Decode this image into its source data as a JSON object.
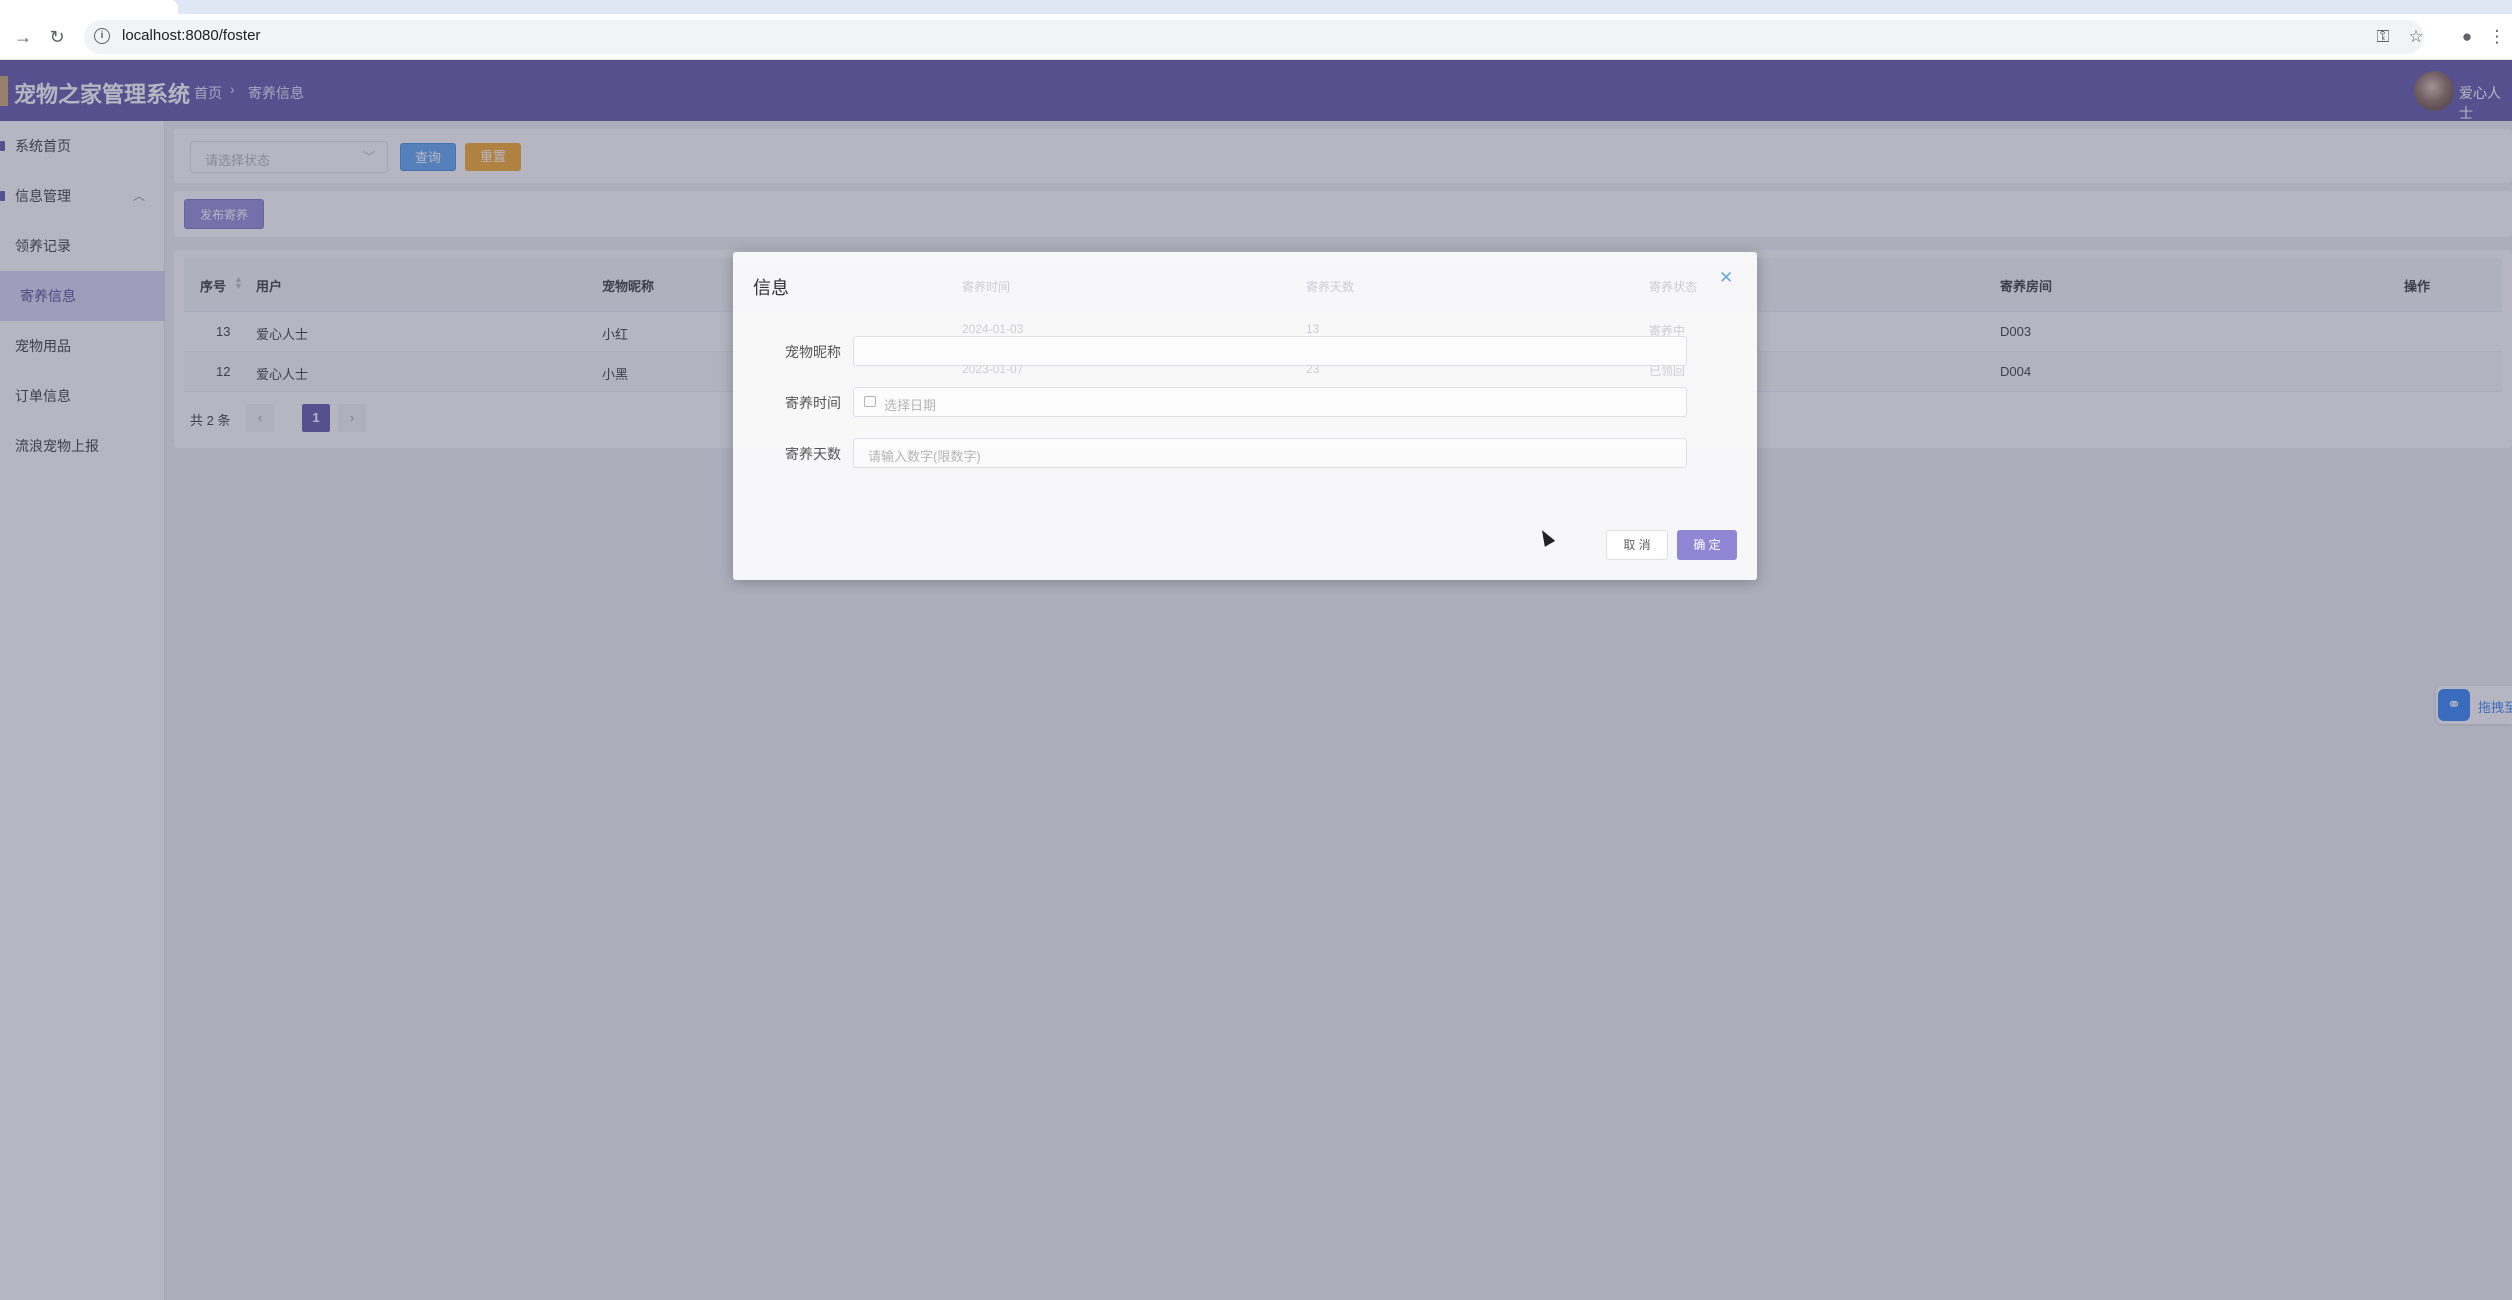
{
  "browser": {
    "url": "localhost:8080/foster"
  },
  "header": {
    "app_title": "宠物之家管理系统",
    "breadcrumb": [
      "首页",
      "寄养信息"
    ],
    "username": "爱心人士"
  },
  "sidebar": {
    "items": [
      {
        "label": "系统首页"
      },
      {
        "label": "信息管理"
      },
      {
        "label": "领养记录"
      },
      {
        "label": "寄养信息"
      },
      {
        "label": "宠物用品"
      },
      {
        "label": "订单信息"
      },
      {
        "label": "流浪宠物上报"
      }
    ]
  },
  "search": {
    "status_placeholder": "请选择状态",
    "query_label": "查询",
    "reset_label": "重置"
  },
  "actions": {
    "publish_label": "发布寄养"
  },
  "table": {
    "columns": [
      "序号",
      "用户",
      "宠物昵称",
      "寄养时间",
      "寄养天数",
      "寄养状态",
      "寄养房间",
      "操作"
    ],
    "rows": [
      {
        "id": "13",
        "user": "爱心人士",
        "pet": "小红",
        "date": "2024-01-03",
        "days": "13",
        "status": "寄养中",
        "room": "D003"
      },
      {
        "id": "12",
        "user": "爱心人士",
        "pet": "小黑",
        "date": "2023-01-07",
        "days": "23",
        "status": "已领回",
        "room": "D004"
      }
    ],
    "total": "共 2 条",
    "current_page": "1"
  },
  "dialog": {
    "title": "信息",
    "fields": [
      {
        "label": "宠物昵称",
        "placeholder": ""
      },
      {
        "label": "寄养时间",
        "placeholder": "选择日期"
      },
      {
        "label": "寄养天数",
        "placeholder": "请输入数字(限数字)"
      }
    ],
    "cancel_label": "取 消",
    "confirm_label": "确 定"
  },
  "widget": {
    "label": "拖拽至"
  },
  "colors": {
    "header_bg": "#5a52a6",
    "accent": "#8f87d6",
    "query_btn": "#5aa3f0",
    "reset_btn": "#f5a623"
  }
}
